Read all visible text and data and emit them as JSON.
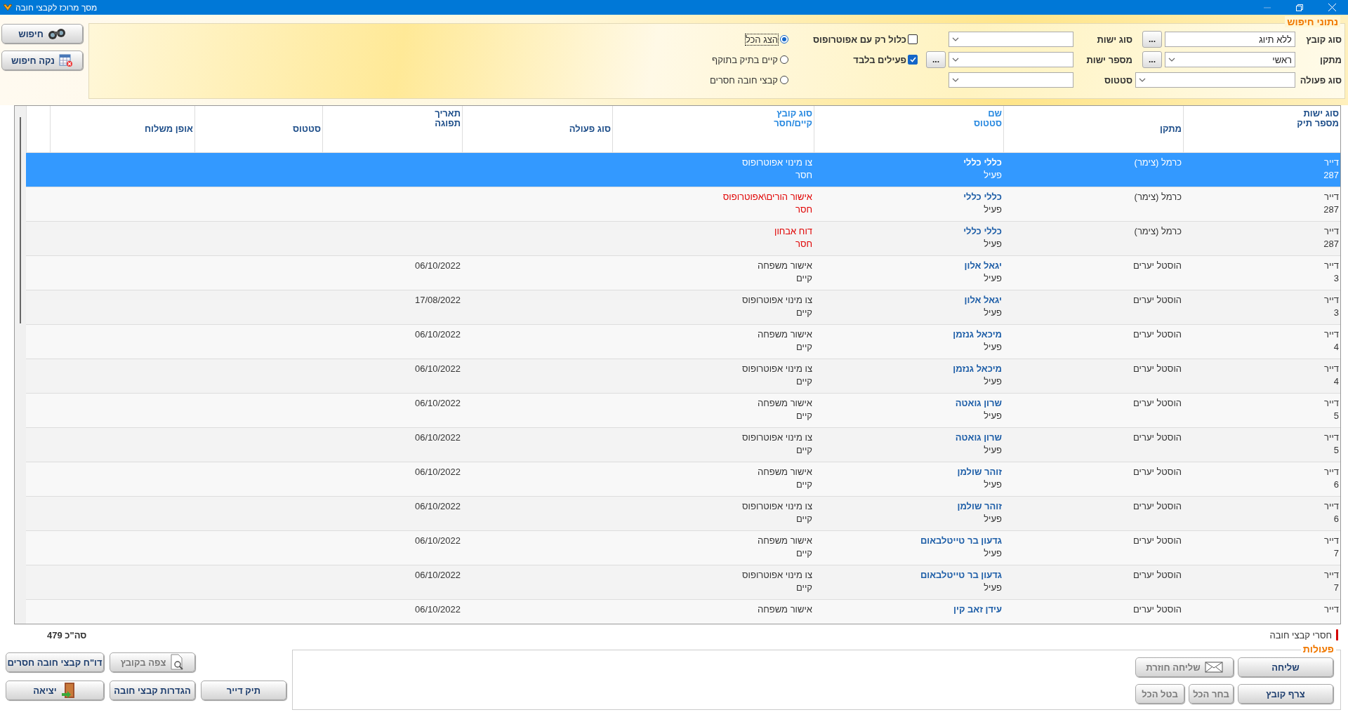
{
  "window": {
    "title": "מסך מרוכז לקבצי חובה"
  },
  "search": {
    "legend": "נתוני חיפוש",
    "file_type": {
      "label": "סוג קובץ",
      "value": "ללא תיוג",
      "browse": "..."
    },
    "entity_type": {
      "label": "סוג ישות"
    },
    "only_with_guardian": {
      "label": "כלול רק עם אפוטרופוס",
      "checked": false
    },
    "facility": {
      "label": "מתקן",
      "value": "ראשי",
      "browse": "..."
    },
    "entity_number": {
      "label": "מספר ישות",
      "browse": "..."
    },
    "active_only": {
      "label": "פעילים בלבד",
      "checked": true
    },
    "action_type": {
      "label": "סוג פעולה"
    },
    "status": {
      "label": "סטטוס"
    },
    "view_options": [
      {
        "label": "הצג הכל",
        "selected": true
      },
      {
        "label": "קיים בתיק בתוקף",
        "selected": false
      },
      {
        "label": "קבצי חובה חסרים",
        "selected": false
      }
    ],
    "buttons": [
      {
        "label": "חיפוש",
        "kind": "search"
      },
      {
        "label": "נקה חיפוש",
        "kind": "clear"
      }
    ]
  },
  "table": {
    "columns": [
      {
        "lines": [
          "סוג ישות",
          "מספר תיק"
        ],
        "highlighted": false
      },
      {
        "lines": [
          "מתקן"
        ],
        "highlighted": false
      },
      {
        "lines": [
          "שם",
          "סטטוס"
        ],
        "highlighted": true
      },
      {
        "lines": [
          "סוג קובץ",
          "קיים/חסר"
        ],
        "highlighted": true
      },
      {
        "lines": [
          "סוג פעולה"
        ],
        "highlighted": false
      },
      {
        "lines": [
          "תאריך",
          "תפוגה"
        ],
        "highlighted": false
      },
      {
        "lines": [
          "סטטוס"
        ],
        "highlighted": false
      },
      {
        "lines": [
          "אופן משלוח"
        ],
        "highlighted": false
      }
    ],
    "rows": [
      {
        "entity_type": "דייר",
        "file_number": "287",
        "facility": "כרמל (צימר)",
        "name": "כללי כללי",
        "status": "פעיל",
        "file_type": "צו מינוי אפוטרופוס",
        "existence": "חסר",
        "missing": true,
        "selected": true
      },
      {
        "entity_type": "דייר",
        "file_number": "287",
        "facility": "כרמל (צימר)",
        "name": "כללי כללי",
        "status": "פעיל",
        "file_type": "אישור הורים\\אפוטרופוס",
        "existence": "חסר",
        "missing": true,
        "selected": false
      },
      {
        "entity_type": "דייר",
        "file_number": "287",
        "facility": "כרמל (צימר)",
        "name": "כללי כללי",
        "status": "פעיל",
        "file_type": "דוח אבחון",
        "existence": "חסר",
        "missing": true,
        "selected": false
      },
      {
        "entity_type": "דייר",
        "file_number": "3",
        "facility": "הוסטל יערים",
        "name": "יגאל אלון",
        "status": "פעיל",
        "file_type": "אישור משפחה",
        "existence": "קיים",
        "missing": false,
        "expiry": "06/10/2022",
        "selected": false
      },
      {
        "entity_type": "דייר",
        "file_number": "3",
        "facility": "הוסטל יערים",
        "name": "יגאל אלון",
        "status": "פעיל",
        "file_type": "צו מינוי אפוטרופוס",
        "existence": "קיים",
        "missing": false,
        "expiry": "17/08/2022",
        "selected": false
      },
      {
        "entity_type": "דייר",
        "file_number": "4",
        "facility": "הוסטל יערים",
        "name": "מיכאל גנזמן",
        "status": "פעיל",
        "file_type": "אישור משפחה",
        "existence": "קיים",
        "missing": false,
        "expiry": "06/10/2022",
        "selected": false
      },
      {
        "entity_type": "דייר",
        "file_number": "4",
        "facility": "הוסטל יערים",
        "name": "מיכאל גנזמן",
        "status": "פעיל",
        "file_type": "צו מינוי אפוטרופוס",
        "existence": "קיים",
        "missing": false,
        "expiry": "06/10/2022",
        "selected": false
      },
      {
        "entity_type": "דייר",
        "file_number": "5",
        "facility": "הוסטל יערים",
        "name": "שרון גואטה",
        "status": "פעיל",
        "file_type": "אישור משפחה",
        "existence": "קיים",
        "missing": false,
        "expiry": "06/10/2022",
        "selected": false
      },
      {
        "entity_type": "דייר",
        "file_number": "5",
        "facility": "הוסטל יערים",
        "name": "שרון גואטה",
        "status": "פעיל",
        "file_type": "צו מינוי אפוטרופוס",
        "existence": "קיים",
        "missing": false,
        "expiry": "06/10/2022",
        "selected": false
      },
      {
        "entity_type": "דייר",
        "file_number": "6",
        "facility": "הוסטל יערים",
        "name": "זוהר שולמן",
        "status": "פעיל",
        "file_type": "אישור משפחה",
        "existence": "קיים",
        "missing": false,
        "expiry": "06/10/2022",
        "selected": false
      },
      {
        "entity_type": "דייר",
        "file_number": "6",
        "facility": "הוסטל יערים",
        "name": "זוהר שולמן",
        "status": "פעיל",
        "file_type": "צו מינוי אפוטרופוס",
        "existence": "קיים",
        "missing": false,
        "expiry": "06/10/2022",
        "selected": false
      },
      {
        "entity_type": "דייר",
        "file_number": "7",
        "facility": "הוסטל יערים",
        "name": "גדעון בר טייטלבאום",
        "status": "פעיל",
        "file_type": "אישור משפחה",
        "existence": "קיים",
        "missing": false,
        "expiry": "06/10/2022",
        "selected": false
      },
      {
        "entity_type": "דייר",
        "file_number": "7",
        "facility": "הוסטל יערים",
        "name": "גדעון בר טייטלבאום",
        "status": "פעיל",
        "file_type": "צו מינוי אפוטרופוס",
        "existence": "קיים",
        "missing": false,
        "expiry": "06/10/2022",
        "selected": false
      },
      {
        "entity_type": "דייר",
        "facility": "הוסטל יערים",
        "name": "עידן זאב קין",
        "file_type": "אישור משפחה",
        "missing": false,
        "expiry": "06/10/2022",
        "selected": false
      }
    ]
  },
  "legend": {
    "label": "חסרי קבצי חובה",
    "color": "#d40000"
  },
  "total": "סה\"כ 479",
  "actions": {
    "legend": "פעולות",
    "buttons": [
      {
        "label": "שליחה",
        "kind": "plain",
        "disabled": false
      },
      {
        "label": "שליחה חוזרת",
        "kind": "envelope",
        "disabled": true
      },
      {
        "label": "צרף קובץ",
        "kind": "plain",
        "disabled": false
      },
      {
        "label": "בחר הכל",
        "kind": "small",
        "disabled": true
      },
      {
        "label": "בטל הכל",
        "kind": "small",
        "disabled": true
      }
    ]
  },
  "side_buttons": [
    {
      "label": "צפה בקובץ",
      "kind": "view",
      "disabled": true
    },
    {
      "label": "דו\"ח קבצי חובה חסרים",
      "kind": "plain",
      "disabled": false
    },
    {
      "label": "תיק דייר",
      "kind": "plain",
      "disabled": false
    },
    {
      "label": "הגדרות קבצי חובה",
      "kind": "plain",
      "disabled": false
    },
    {
      "label": "יציאה",
      "kind": "exit",
      "disabled": false
    }
  ]
}
